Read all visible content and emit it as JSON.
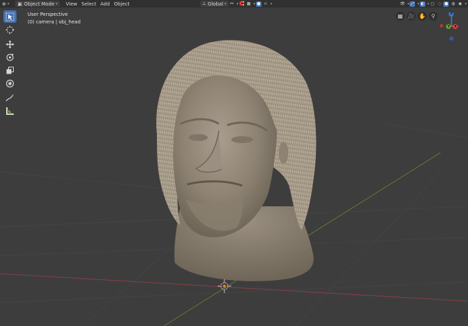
{
  "header": {
    "mode_label": "Object Mode",
    "menus": [
      "View",
      "Select",
      "Add",
      "Object"
    ],
    "transform_orientation": "Global"
  },
  "viewport_info": {
    "view_name": "User Perspective",
    "collection_object": "(0) camera | obj_head"
  },
  "gizmo": {
    "x_label": "X",
    "y_label": "Y",
    "z_label": "Z",
    "x_color": "#e6454f",
    "y_color": "#6ea82e",
    "z_color": "#3d7fd6"
  },
  "toolbar": {
    "tools": [
      "select-box",
      "cursor",
      "move",
      "rotate",
      "scale",
      "transform",
      "annotate",
      "measure"
    ],
    "active_tool": "select-box"
  },
  "colors": {
    "viewport_bg": "#3d3d3d",
    "header_bg": "#303030",
    "active_blue": "#4772b3",
    "x_axis_line": "#8a3f47",
    "y_axis_line": "#5e7a34",
    "model_base": "#8c8070"
  }
}
